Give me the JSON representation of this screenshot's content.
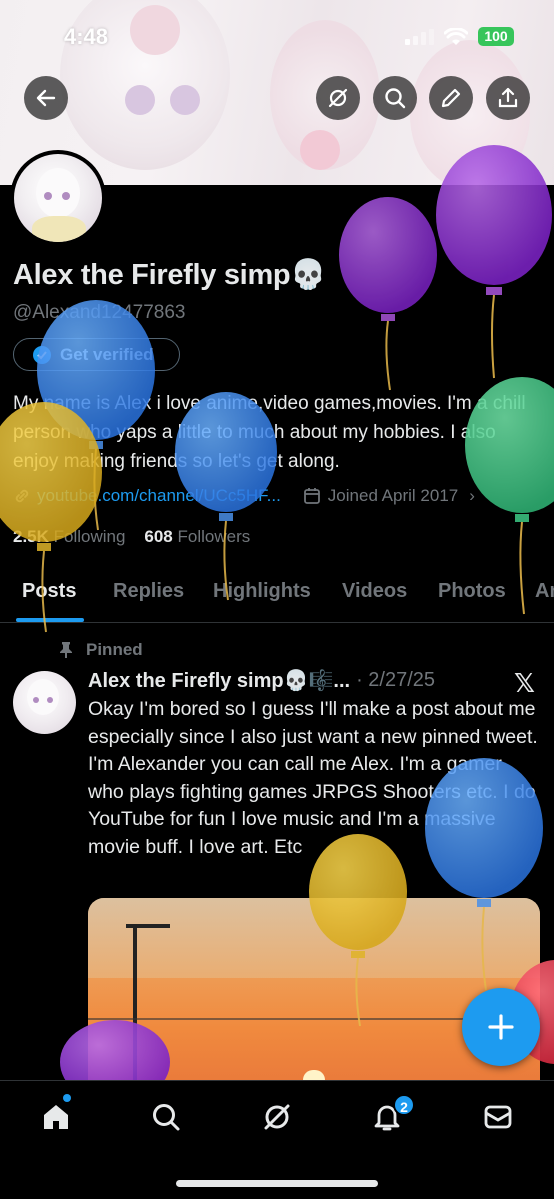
{
  "status_bar": {
    "time": "4:48",
    "battery": "100"
  },
  "header": {
    "back": "back-arrow-icon",
    "icons": [
      "grok-icon",
      "search-icon",
      "edit-icon",
      "share-icon"
    ]
  },
  "profile": {
    "name": "Alex the Firefly simp💀",
    "handle": "@Alexand12477863",
    "verify_label": "Get verified",
    "bio": "My name is Alex i love anime,video games,movies. I'm a chill person who yaps a little to much about my hobbies. I also enjoy making friends so let's get along.",
    "link": "youtube.com/channel/UCc5HF...",
    "joined": "Joined April 2017",
    "following_count": "2.5K",
    "following_label": "Following",
    "followers_count": "608",
    "followers_label": "Followers"
  },
  "tabs": [
    "Posts",
    "Replies",
    "Highlights",
    "Videos",
    "Photos",
    "Ar"
  ],
  "tweet": {
    "pinned_label": "Pinned",
    "author": "Alex the Firefly simp💀🎼...",
    "date": "· 2/27/25",
    "text": "Okay I'm bored so I guess I'll make a post about me especially since I also just want a new pinned tweet. I'm Alexander you can call me Alex. I'm a gamer who plays fighting games JRPGS Shooters etc. I do YouTube for fun I love music and I'm a massive movie buff. I love art. Etc"
  },
  "nav": {
    "notification_badge": "2"
  },
  "colors": {
    "accent": "#1d9bf0",
    "background": "#000000",
    "muted": "#71767b",
    "text": "#e7e9ea"
  }
}
